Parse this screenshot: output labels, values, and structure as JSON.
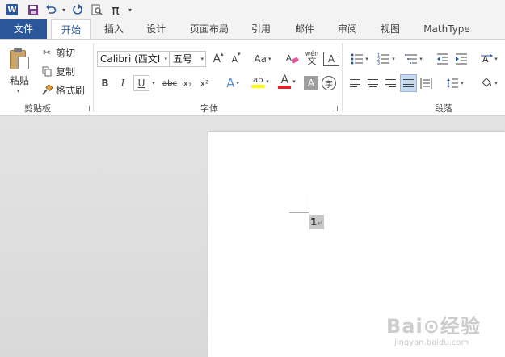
{
  "quick_access": {
    "app_logo": "W",
    "icons": [
      "save-icon",
      "undo-icon",
      "redo-icon",
      "print-preview-icon",
      "pi-icon"
    ],
    "pi_glyph": "π"
  },
  "tabs": [
    {
      "label": "文件"
    },
    {
      "label": "开始"
    },
    {
      "label": "插入"
    },
    {
      "label": "设计"
    },
    {
      "label": "页面布局"
    },
    {
      "label": "引用"
    },
    {
      "label": "邮件"
    },
    {
      "label": "审阅"
    },
    {
      "label": "视图"
    },
    {
      "label": "MathType"
    }
  ],
  "active_tab": "开始",
  "clipboard": {
    "paste_label": "粘贴",
    "cut_label": "剪切",
    "copy_label": "复制",
    "format_painter_label": "格式刷",
    "group_label": "剪贴板"
  },
  "font": {
    "font_name": "Calibri (西文I",
    "font_size": "五号",
    "grow_glyph": "A",
    "shrink_glyph": "A",
    "case_glyph": "Aa",
    "phonetic_glyph": "wén",
    "charborder_glyph": "A",
    "bold": "B",
    "italic": "I",
    "underline": "U",
    "strike": "abc",
    "subscript": "x₂",
    "superscript": "x²",
    "text_effect_glyph": "A",
    "highlight_glyph": "ab",
    "font_color_glyph": "A",
    "char_shading_glyph": "A",
    "enclose_glyph": "字",
    "group_label": "字体",
    "font_color_hex": "#d9272e",
    "highlight_hex": "#ffff00"
  },
  "paragraph": {
    "group_label": "段落"
  },
  "document": {
    "text": "1",
    "paragraph_mark": "↵"
  },
  "watermark": {
    "brand": "Bai⊙经验",
    "url": "jingyan.baidu.com"
  }
}
